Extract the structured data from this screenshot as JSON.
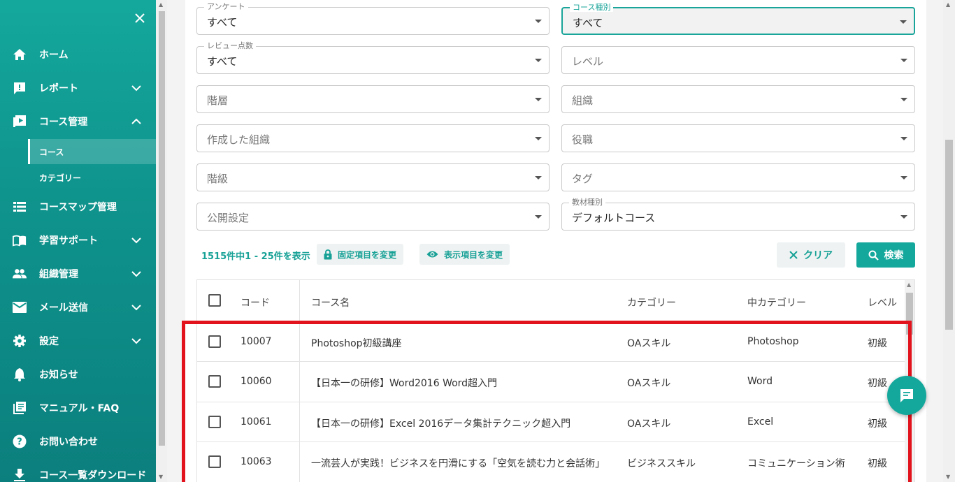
{
  "sidebar": {
    "items": [
      {
        "label": "ホーム",
        "icon": "home-icon"
      },
      {
        "label": "レポート",
        "icon": "report-icon"
      },
      {
        "label": "コース管理",
        "icon": "course-icon"
      },
      {
        "label": "コースマップ管理",
        "icon": "list-icon"
      },
      {
        "label": "学習サポート",
        "icon": "book-icon"
      },
      {
        "label": "組織管理",
        "icon": "group-icon"
      },
      {
        "label": "メール送信",
        "icon": "mail-icon"
      },
      {
        "label": "設定",
        "icon": "gear-icon"
      },
      {
        "label": "お知らせ",
        "icon": "bell-icon"
      },
      {
        "label": "マニュアル・FAQ",
        "icon": "manual-icon"
      },
      {
        "label": "お問い合わせ",
        "icon": "help-icon"
      },
      {
        "label": "コース一覧ダウンロード",
        "icon": "download-icon"
      }
    ],
    "sub_items": [
      {
        "label": "コース"
      },
      {
        "label": "カテゴリー"
      }
    ]
  },
  "filters": {
    "questionnaire": {
      "label": "アンケート",
      "value": "すべて"
    },
    "course_type": {
      "label": "コース種別",
      "value": "すべて"
    },
    "review_score": {
      "label": "レビュー点数",
      "value": "すべて"
    },
    "level": {
      "placeholder": "レベル"
    },
    "hierarchy": {
      "placeholder": "階層"
    },
    "organization": {
      "placeholder": "組織"
    },
    "created_org": {
      "placeholder": "作成した組織"
    },
    "position": {
      "placeholder": "役職"
    },
    "rank": {
      "placeholder": "階級"
    },
    "tag": {
      "placeholder": "タグ"
    },
    "publish": {
      "placeholder": "公開設定"
    },
    "material_type": {
      "label": "教材種別",
      "value": "デフォルトコース"
    }
  },
  "toolbar": {
    "count_text": "1515件中1 - 25件を表示",
    "fixed_items_label": "固定項目を変更",
    "display_items_label": "表示項目を変更",
    "clear_label": "クリア",
    "search_label": "検索"
  },
  "table": {
    "headers": {
      "code": "コード",
      "name": "コース名",
      "category": "カテゴリー",
      "subcategory": "中カテゴリー",
      "level": "レベル"
    },
    "rows": [
      {
        "code": "10007",
        "name": "Photoshop初級講座",
        "category": "OAスキル",
        "subcategory": "Photoshop",
        "level": "初級"
      },
      {
        "code": "10060",
        "name": "【日本一の研修】Word2016 Word超入門",
        "category": "OAスキル",
        "subcategory": "Word",
        "level": "初級"
      },
      {
        "code": "10061",
        "name": "【日本一の研修】Excel 2016データ集計テクニック超入門",
        "category": "OAスキル",
        "subcategory": "Excel",
        "level": "初級"
      },
      {
        "code": "10063",
        "name": "一流芸人が実践！ビジネスを円滑にする「空気を読む力と会話術」",
        "category": "ビジネススキル",
        "subcategory": "コミュニケーション術",
        "level": "初級"
      }
    ]
  },
  "colors": {
    "accent": "#14a89c",
    "highlight": "#e2131c"
  }
}
